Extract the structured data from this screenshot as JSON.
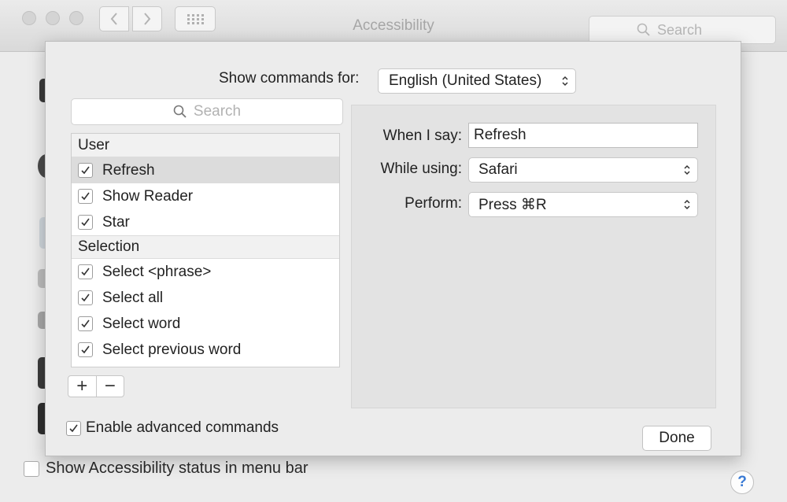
{
  "window": {
    "title": "Accessibility",
    "search_placeholder": "Search",
    "status_checkbox_label": "Show Accessibility status in menu bar",
    "help_label": "?"
  },
  "sheet": {
    "language_label": "Show commands for:",
    "language_value": "English (United States)",
    "search_placeholder": "Search",
    "groups": [
      {
        "header": "User",
        "items": [
          {
            "label": "Refresh",
            "checked": true,
            "selected": true
          },
          {
            "label": "Show Reader",
            "checked": true,
            "selected": false
          },
          {
            "label": "Star",
            "checked": true,
            "selected": false
          }
        ]
      },
      {
        "header": "Selection",
        "items": [
          {
            "label": "Select <phrase>",
            "checked": true,
            "selected": false
          },
          {
            "label": "Select all",
            "checked": true,
            "selected": false
          },
          {
            "label": "Select word",
            "checked": true,
            "selected": false
          },
          {
            "label": "Select previous word",
            "checked": true,
            "selected": false
          }
        ]
      }
    ],
    "add_label": "+",
    "remove_label": "−",
    "detail": {
      "when_label": "When I say:",
      "when_value": "Refresh",
      "using_label": "While using:",
      "using_value": "Safari",
      "perform_label": "Perform:",
      "perform_value": "Press ⌘R"
    },
    "advanced_label": "Enable advanced commands",
    "advanced_checked": true,
    "done_label": "Done"
  }
}
